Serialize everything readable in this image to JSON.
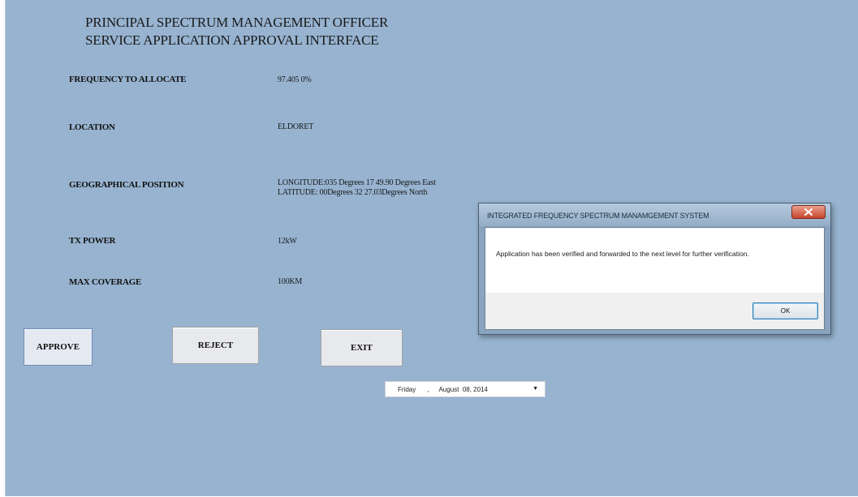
{
  "header": {
    "title_line1": "PRINCIPAL SPECTRUM MANAGEMENT OFFICER",
    "title_line2": "SERVICE APPLICATION  APPROVAL INTERFACE"
  },
  "fields": {
    "frequency": {
      "label": "FREQUENCY TO ALLOCATE",
      "value": "97.405 0%"
    },
    "location": {
      "label": "LOCATION",
      "value": "ELDORET"
    },
    "position": {
      "label": "GEOGRAPHICAL POSITION",
      "value_line1": "LONGITUDE:035 Degrees 17 49.90 Degrees East",
      "value_line2": "LATITUDE: 00Degrees 32 27.03Degrees North"
    },
    "tx_power": {
      "label": "TX POWER",
      "value": "12kW"
    },
    "max_coverage": {
      "label": "MAX COVERAGE",
      "value": "100KM"
    }
  },
  "buttons": {
    "approve": "APPROVE",
    "reject": "REJECT",
    "exit": "EXIT"
  },
  "date_picker": {
    "day": "Friday",
    "separator": ",",
    "date": "August  08, 2014",
    "dropdown_icon": "chevron-down-icon"
  },
  "dialog": {
    "title": "INTEGRATED FREQUENCY SPECTRUM MANAMGEMENT SYSTEM",
    "close_icon": "close-icon",
    "message": "Application has been verified and forwarded to the next level for further verification.",
    "ok_label": "OK"
  },
  "colors": {
    "background": "#97b3d0",
    "dialog_close": "#c8442a",
    "ok_border": "#3c7fb1"
  }
}
